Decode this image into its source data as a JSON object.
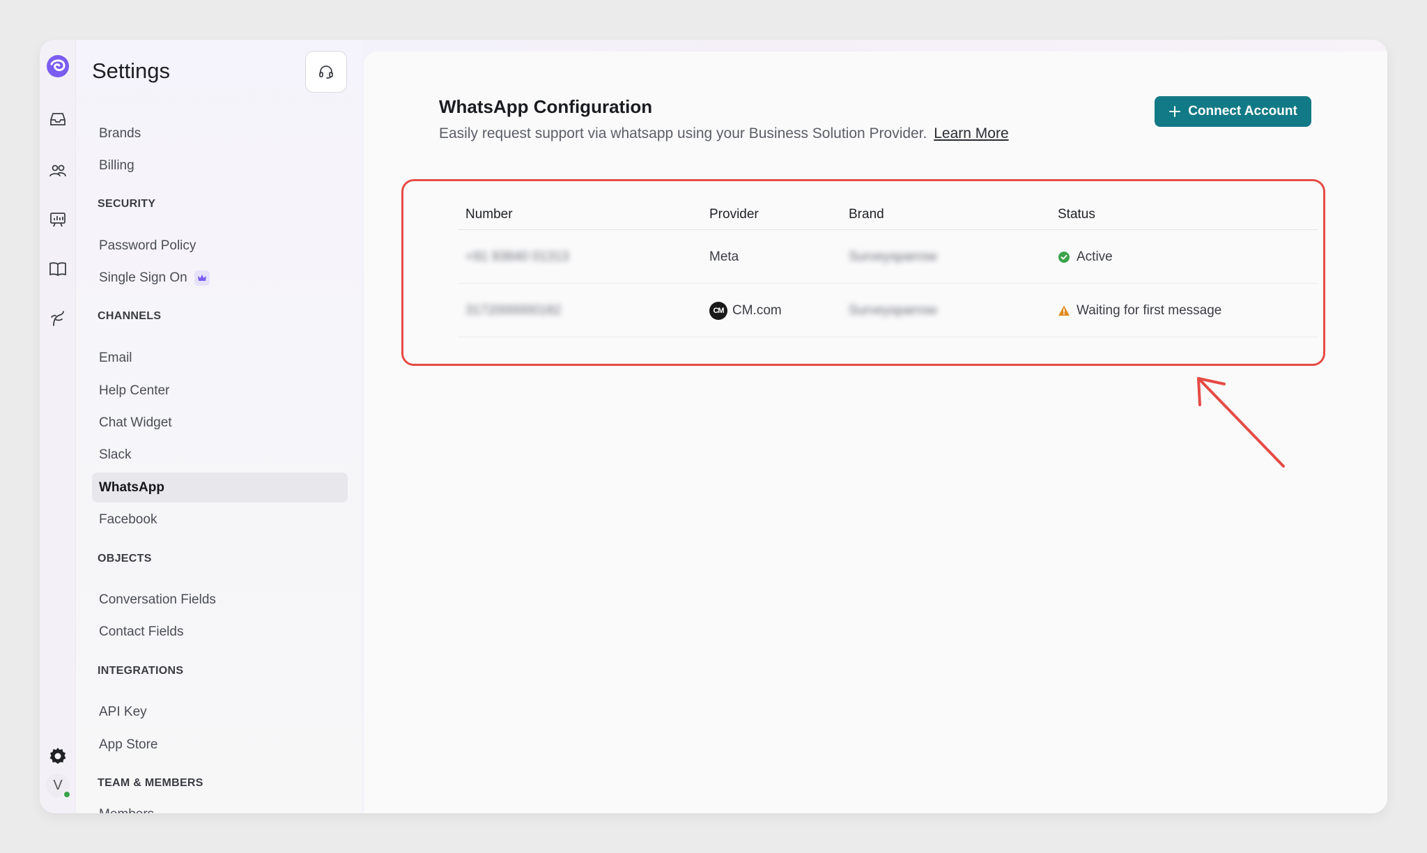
{
  "sidebar": {
    "title": "Settings",
    "items_top": [
      "Brands",
      "Billing"
    ],
    "security": {
      "heading": "SECURITY",
      "items": [
        "Password Policy",
        "Single Sign On"
      ]
    },
    "channels": {
      "heading": "CHANNELS",
      "items": [
        "Email",
        "Help Center",
        "Chat Widget",
        "Slack",
        "WhatsApp",
        "Facebook"
      ],
      "active": "WhatsApp"
    },
    "objects": {
      "heading": "OBJECTS",
      "items": [
        "Conversation Fields",
        "Contact Fields"
      ]
    },
    "integrations": {
      "heading": "INTEGRATIONS",
      "items": [
        "API Key",
        "App Store"
      ]
    },
    "team": {
      "heading": "TEAM & MEMBERS",
      "items": [
        "Members"
      ]
    }
  },
  "rail": {
    "icons": [
      "logo-icon",
      "inbox-icon",
      "contacts-icon",
      "reports-icon",
      "knowledge-book-icon",
      "automation-icon",
      "settings-gear-icon"
    ],
    "avatar_initial": "V"
  },
  "main": {
    "title": "WhatsApp Configuration",
    "description": "Easily request support via whatsapp using your Business Solution Provider.",
    "learn_more": "Learn More",
    "connect_button": "Connect Account",
    "table": {
      "headers": {
        "number": "Number",
        "provider": "Provider",
        "brand": "Brand",
        "status": "Status"
      },
      "rows": [
        {
          "number": "+91 93840 01313",
          "provider": "Meta",
          "brand": "Surveysparrow",
          "status": "Active"
        },
        {
          "number": "3172000000182",
          "provider": "CM.com",
          "brand": "Surveysparrow",
          "status": "Waiting for first message"
        }
      ]
    }
  },
  "colors": {
    "accent": "#127a86",
    "highlight": "#e64b45",
    "active_status": "#3aa34a",
    "warning_status": "#e08a1e"
  }
}
